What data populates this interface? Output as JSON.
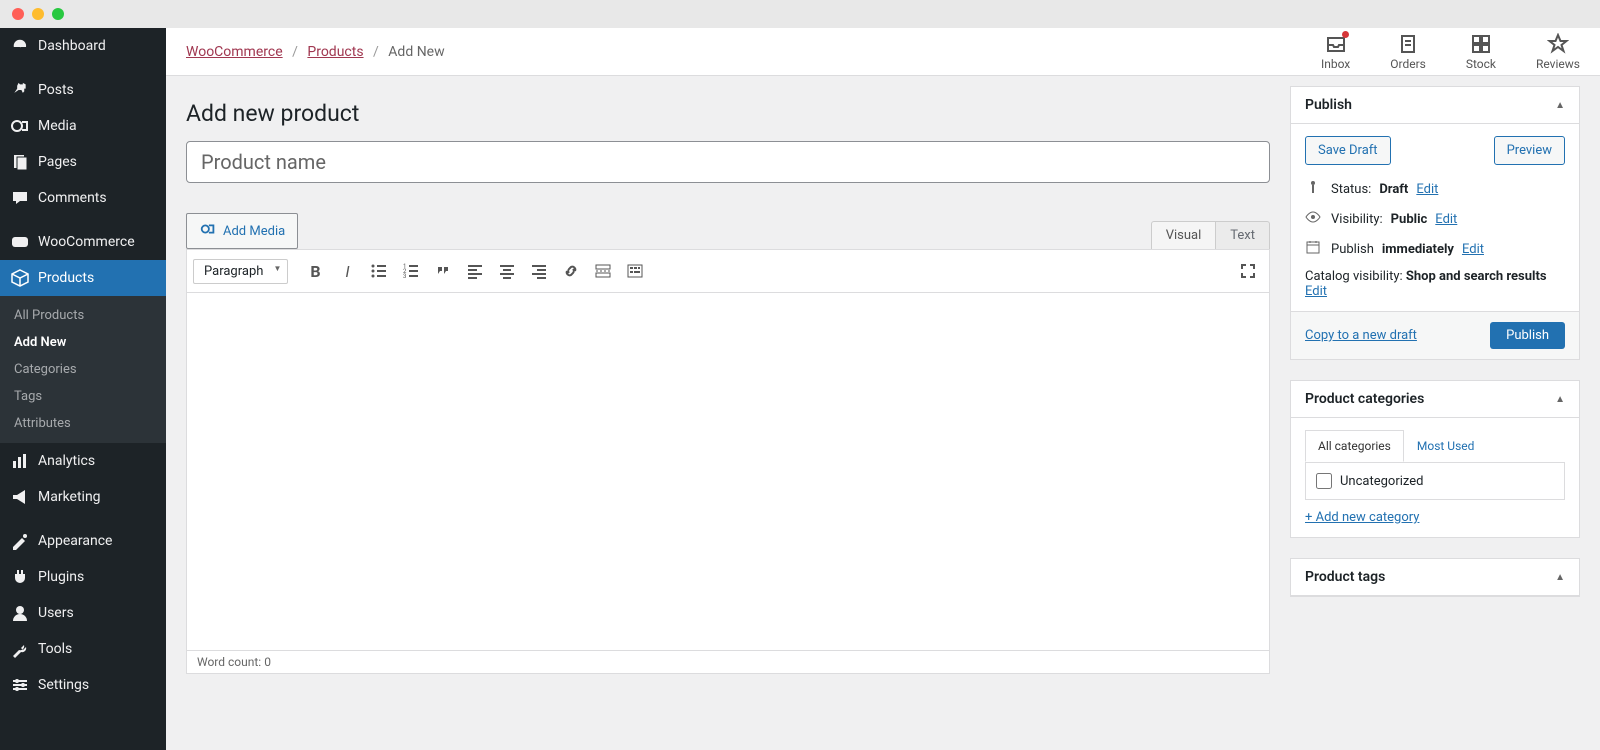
{
  "sidebar": {
    "items": [
      {
        "label": "Dashboard"
      },
      {
        "label": "Posts"
      },
      {
        "label": "Media"
      },
      {
        "label": "Pages"
      },
      {
        "label": "Comments"
      },
      {
        "label": "WooCommerce"
      },
      {
        "label": "Products"
      },
      {
        "label": "Analytics"
      },
      {
        "label": "Marketing"
      },
      {
        "label": "Appearance"
      },
      {
        "label": "Plugins"
      },
      {
        "label": "Users"
      },
      {
        "label": "Tools"
      },
      {
        "label": "Settings"
      }
    ],
    "sub": [
      {
        "label": "All Products"
      },
      {
        "label": "Add New"
      },
      {
        "label": "Categories"
      },
      {
        "label": "Tags"
      },
      {
        "label": "Attributes"
      }
    ]
  },
  "breadcrumb": {
    "a": "WooCommerce",
    "b": "Products",
    "c": "Add New"
  },
  "topbar": [
    {
      "label": "Inbox"
    },
    {
      "label": "Orders"
    },
    {
      "label": "Stock"
    },
    {
      "label": "Reviews"
    }
  ],
  "page_title": "Add new product",
  "product_name_placeholder": "Product name",
  "editor": {
    "add_media": "Add Media",
    "tab_visual": "Visual",
    "tab_text": "Text",
    "paragraph": "Paragraph",
    "word_count_label": "Word count: ",
    "word_count": "0"
  },
  "publish": {
    "title": "Publish",
    "save_draft": "Save Draft",
    "preview": "Preview",
    "status_label": "Status: ",
    "status_value": "Draft",
    "visibility_label": "Visibility: ",
    "visibility_value": "Public",
    "publish_label": "Publish ",
    "publish_value": "immediately",
    "catalog_label": "Catalog visibility: ",
    "catalog_value": "Shop and search results",
    "edit": "Edit",
    "copy_link": "Copy to a new draft",
    "publish_btn": "Publish"
  },
  "categories": {
    "title": "Product categories",
    "tab_all": "All categories",
    "tab_most": "Most Used",
    "item": "Uncategorized",
    "add_link": "+ Add new category"
  },
  "tags": {
    "title": "Product tags"
  }
}
